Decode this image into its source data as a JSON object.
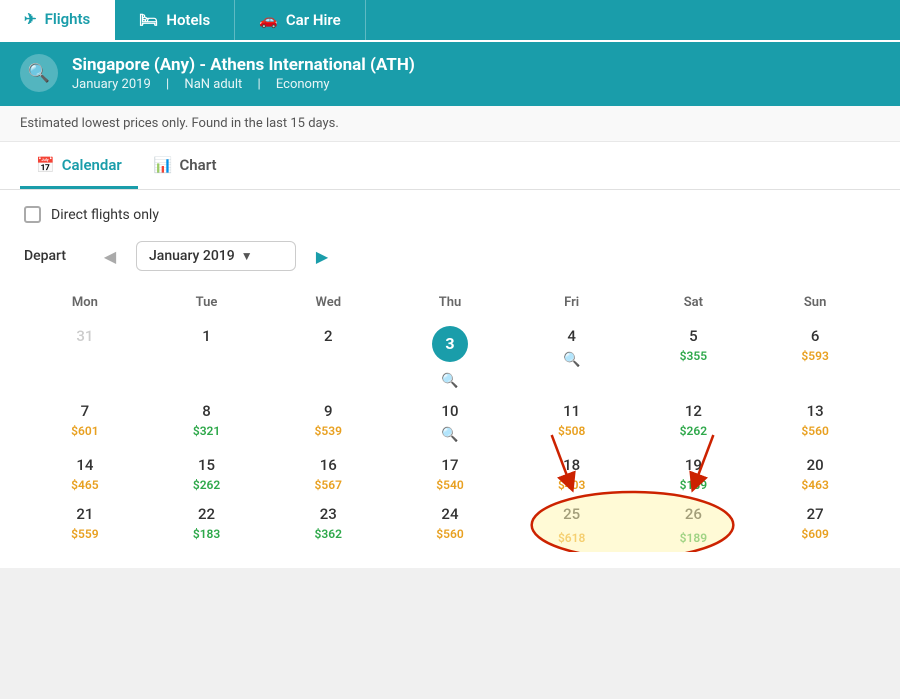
{
  "nav": {
    "tabs": [
      {
        "id": "flights",
        "label": "Flights",
        "icon": "✈",
        "active": true
      },
      {
        "id": "hotels",
        "label": "Hotels",
        "icon": "🛏",
        "active": false
      },
      {
        "id": "carhire",
        "label": "Car Hire",
        "icon": "🚗",
        "active": false
      }
    ]
  },
  "search": {
    "icon": "🔍",
    "route": "Singapore (Any) - Athens International (ATH)",
    "month": "January 2019",
    "adults": "NaN adult",
    "cabin": "Economy"
  },
  "notice": "Estimated lowest prices only. Found in the last 15 days.",
  "viewTabs": [
    {
      "id": "calendar",
      "label": "Calendar",
      "icon": "📅",
      "active": true
    },
    {
      "id": "chart",
      "label": "Chart",
      "icon": "📊",
      "active": false
    }
  ],
  "directFlights": {
    "label": "Direct flights only",
    "checked": false
  },
  "depart": {
    "label": "Depart",
    "month": "January 2019"
  },
  "calendar": {
    "headers": [
      "Mon",
      "Tue",
      "Wed",
      "Thu",
      "Fri",
      "Sat",
      "Sun"
    ],
    "weeks": [
      [
        {
          "day": "31",
          "muted": true,
          "price": null,
          "type": null
        },
        {
          "day": "1",
          "muted": false,
          "price": null,
          "type": null
        },
        {
          "day": "2",
          "muted": false,
          "price": null,
          "type": null
        },
        {
          "day": "3",
          "muted": false,
          "price": null,
          "type": null,
          "today": true,
          "searchIcon": true
        },
        {
          "day": "4",
          "muted": false,
          "price": null,
          "type": null,
          "searchIcon": true
        },
        {
          "day": "5",
          "muted": false,
          "price": "$355",
          "type": "green"
        },
        {
          "day": "6",
          "muted": false,
          "price": "$593",
          "type": "orange"
        }
      ],
      [
        {
          "day": "7",
          "muted": false,
          "price": "$601",
          "type": "orange"
        },
        {
          "day": "8",
          "muted": false,
          "price": "$321",
          "type": "green"
        },
        {
          "day": "9",
          "muted": false,
          "price": "$539",
          "type": "orange"
        },
        {
          "day": "10",
          "muted": false,
          "price": null,
          "type": null,
          "searchIcon": true
        },
        {
          "day": "11",
          "muted": false,
          "price": "$508",
          "type": "orange"
        },
        {
          "day": "12",
          "muted": false,
          "price": "$262",
          "type": "green"
        },
        {
          "day": "13",
          "muted": false,
          "price": "$560",
          "type": "orange"
        }
      ],
      [
        {
          "day": "14",
          "muted": false,
          "price": "$465",
          "type": "orange"
        },
        {
          "day": "15",
          "muted": false,
          "price": "$262",
          "type": "green"
        },
        {
          "day": "16",
          "muted": false,
          "price": "$567",
          "type": "orange"
        },
        {
          "day": "17",
          "muted": false,
          "price": "$540",
          "type": "orange"
        },
        {
          "day": "18",
          "muted": false,
          "price": "$403",
          "type": "orange"
        },
        {
          "day": "19",
          "muted": false,
          "price": "$189",
          "type": "green"
        },
        {
          "day": "20",
          "muted": false,
          "price": "$463",
          "type": "orange"
        }
      ],
      [
        {
          "day": "21",
          "muted": false,
          "price": "$559",
          "type": "orange"
        },
        {
          "day": "22",
          "muted": false,
          "price": "$183",
          "type": "green"
        },
        {
          "day": "23",
          "muted": false,
          "price": "$362",
          "type": "green"
        },
        {
          "day": "24",
          "muted": false,
          "price": "$560",
          "type": "orange"
        },
        {
          "day": "25",
          "muted": false,
          "price": "$618",
          "type": "orange",
          "highlighted": true
        },
        {
          "day": "26",
          "muted": false,
          "price": "$189",
          "type": "green",
          "highlighted": true
        },
        {
          "day": "27",
          "muted": false,
          "price": "$609",
          "type": "orange"
        }
      ]
    ]
  }
}
